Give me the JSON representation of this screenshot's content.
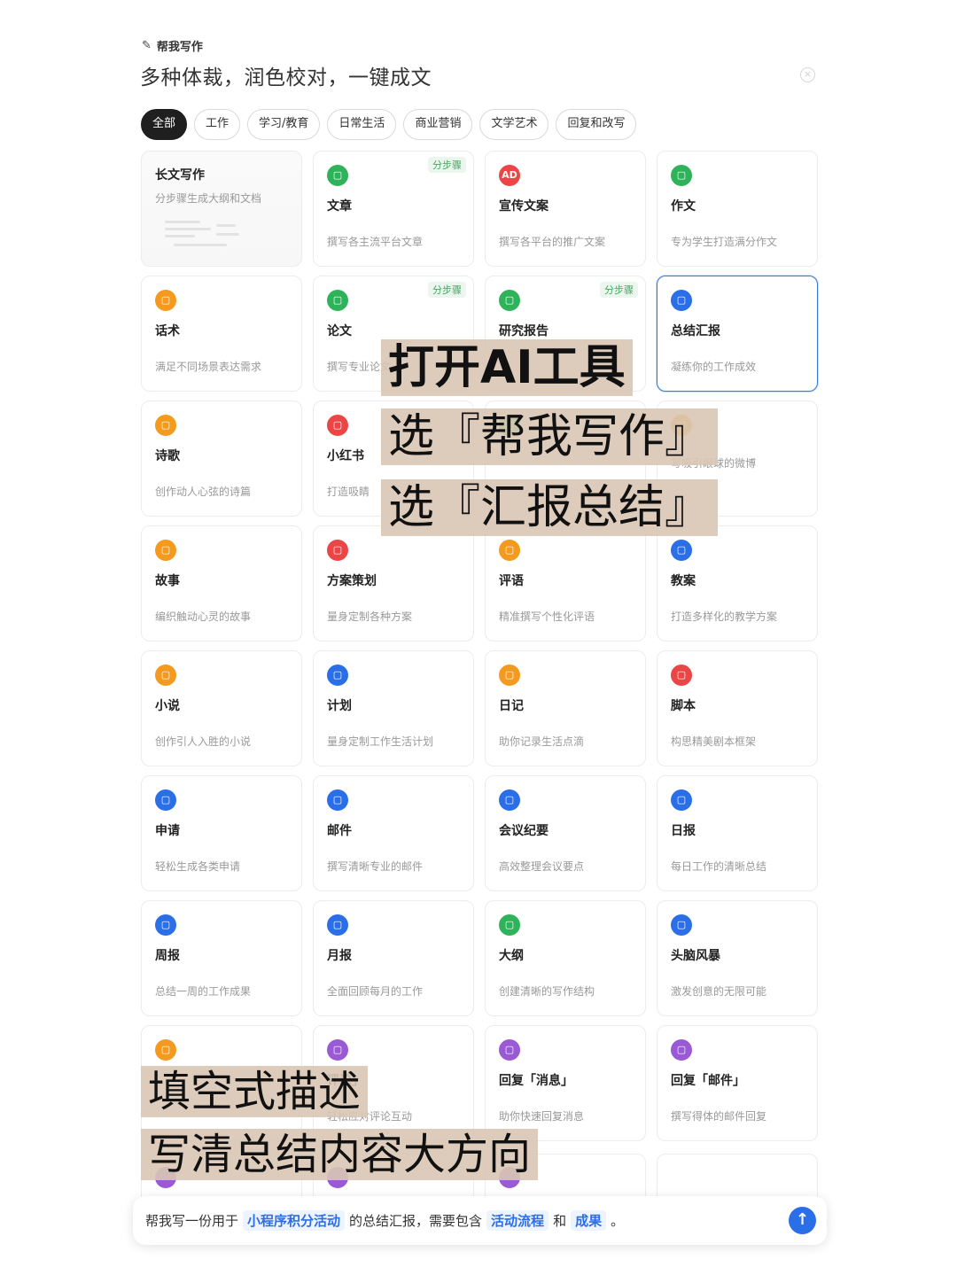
{
  "header": {
    "icon": "pen-sparkle-icon",
    "label": "帮我写作",
    "title": "多种体裁，润色校对，一键成文",
    "close_icon": "close-icon"
  },
  "filters": [
    {
      "label": "全部",
      "active": true
    },
    {
      "label": "工作"
    },
    {
      "label": "学习/教育"
    },
    {
      "label": "日常生活"
    },
    {
      "label": "商业营销"
    },
    {
      "label": "文学艺术"
    },
    {
      "label": "回复和改写"
    }
  ],
  "cards": [
    {
      "title": "长文写作",
      "desc": "分步骤生成大纲和文档",
      "type": "long"
    },
    {
      "title": "文章",
      "desc": "撰写各主流平台文章",
      "icon": "document-icon",
      "color": "green",
      "badge": "分步骤"
    },
    {
      "title": "宣传文案",
      "desc": "撰写各平台的推广文案",
      "icon": "ad-icon",
      "color": "red"
    },
    {
      "title": "作文",
      "desc": "专为学生打造满分作文",
      "icon": "pen-icon",
      "color": "green"
    },
    {
      "title": "话术",
      "desc": "满足不同场景表达需求",
      "icon": "person-icon",
      "color": "orange"
    },
    {
      "title": "论文",
      "desc": "撰写专业论文",
      "icon": "chart-icon",
      "color": "green",
      "badge": "分步骤"
    },
    {
      "title": "研究报告",
      "desc": "",
      "icon": "report-icon",
      "color": "green",
      "badge": "分步骤"
    },
    {
      "title": "总结汇报",
      "desc": "凝练你的工作成效",
      "icon": "summary-icon",
      "color": "blue",
      "selected": true
    },
    {
      "title": "诗歌",
      "desc": "创作动人心弦的诗篇",
      "icon": "poem-icon",
      "color": "orange"
    },
    {
      "title": "小红书",
      "desc": "打造吸睛",
      "icon": "redbook-icon",
      "color": "red"
    },
    {
      "title": "",
      "desc": "",
      "icon": "moments-icon",
      "color": "green"
    },
    {
      "title": "",
      "desc": "写吸引眼球的微博",
      "icon": "weibo-icon",
      "color": "orange"
    },
    {
      "title": "故事",
      "desc": "编织触动心灵的故事",
      "icon": "bulb-icon",
      "color": "orange"
    },
    {
      "title": "方案策划",
      "desc": "量身定制各种方案",
      "icon": "plan-icon",
      "color": "red"
    },
    {
      "title": "评语",
      "desc": "精准撰写个性化评语",
      "icon": "comment-icon",
      "color": "orange"
    },
    {
      "title": "教案",
      "desc": "打造多样化的教学方案",
      "icon": "lesson-icon",
      "color": "blue"
    },
    {
      "title": "小说",
      "desc": "创作引人入胜的小说",
      "icon": "book-icon",
      "color": "orange"
    },
    {
      "title": "计划",
      "desc": "量身定制工作生活计划",
      "icon": "calendar-icon",
      "color": "blue"
    },
    {
      "title": "日记",
      "desc": "助你记录生活点滴",
      "icon": "diary-icon",
      "color": "orange"
    },
    {
      "title": "脚本",
      "desc": "构思精美剧本框架",
      "icon": "script-icon",
      "color": "red"
    },
    {
      "title": "申请",
      "desc": "轻松生成各类申请",
      "icon": "apply-icon",
      "color": "blue"
    },
    {
      "title": "邮件",
      "desc": "撰写清晰专业的邮件",
      "icon": "mail-icon",
      "color": "blue"
    },
    {
      "title": "会议纪要",
      "desc": "高效整理会议要点",
      "icon": "meeting-icon",
      "color": "blue"
    },
    {
      "title": "日报",
      "desc": "每日工作的清晰总结",
      "icon": "daily-icon",
      "color": "blue"
    },
    {
      "title": "周报",
      "desc": "总结一周的工作成果",
      "icon": "weekly-icon",
      "color": "blue"
    },
    {
      "title": "月报",
      "desc": "全面回顾每月的工作",
      "icon": "monthly-icon",
      "color": "blue"
    },
    {
      "title": "大纲",
      "desc": "创建清晰的写作结构",
      "icon": "outline-icon",
      "color": "green"
    },
    {
      "title": "头脑风暴",
      "desc": "激发创意的无限可能",
      "icon": "brainstorm-icon",
      "color": "blue"
    },
    {
      "title": "",
      "desc": "",
      "icon": "blog-icon",
      "color": "orange"
    },
    {
      "title": "评论」",
      "desc": "轻松应对评论互动",
      "icon": "chat-icon",
      "color": "purple"
    },
    {
      "title": "回复「消息」",
      "desc": "助你快速回复消息",
      "icon": "message-icon",
      "color": "purple"
    },
    {
      "title": "回复「邮件」",
      "desc": "撰写得体的邮件回复",
      "icon": "mail-reply-icon",
      "color": "purple"
    }
  ],
  "input": {
    "prefix": "帮我写一份用于",
    "slot1": "小程序积分活动",
    "mid1": "的总结汇报，需要包含",
    "slot2": "活动流程",
    "mid2": "和",
    "slot3": "成果",
    "suffix": "。",
    "send_icon": "arrow-up-icon"
  },
  "overlays": {
    "step1": "打开AI工具",
    "step2": "选『帮我写作』",
    "step3": "选『汇报总结』",
    "step4": "填空式描述",
    "step5": "写清总结内容大方向"
  }
}
